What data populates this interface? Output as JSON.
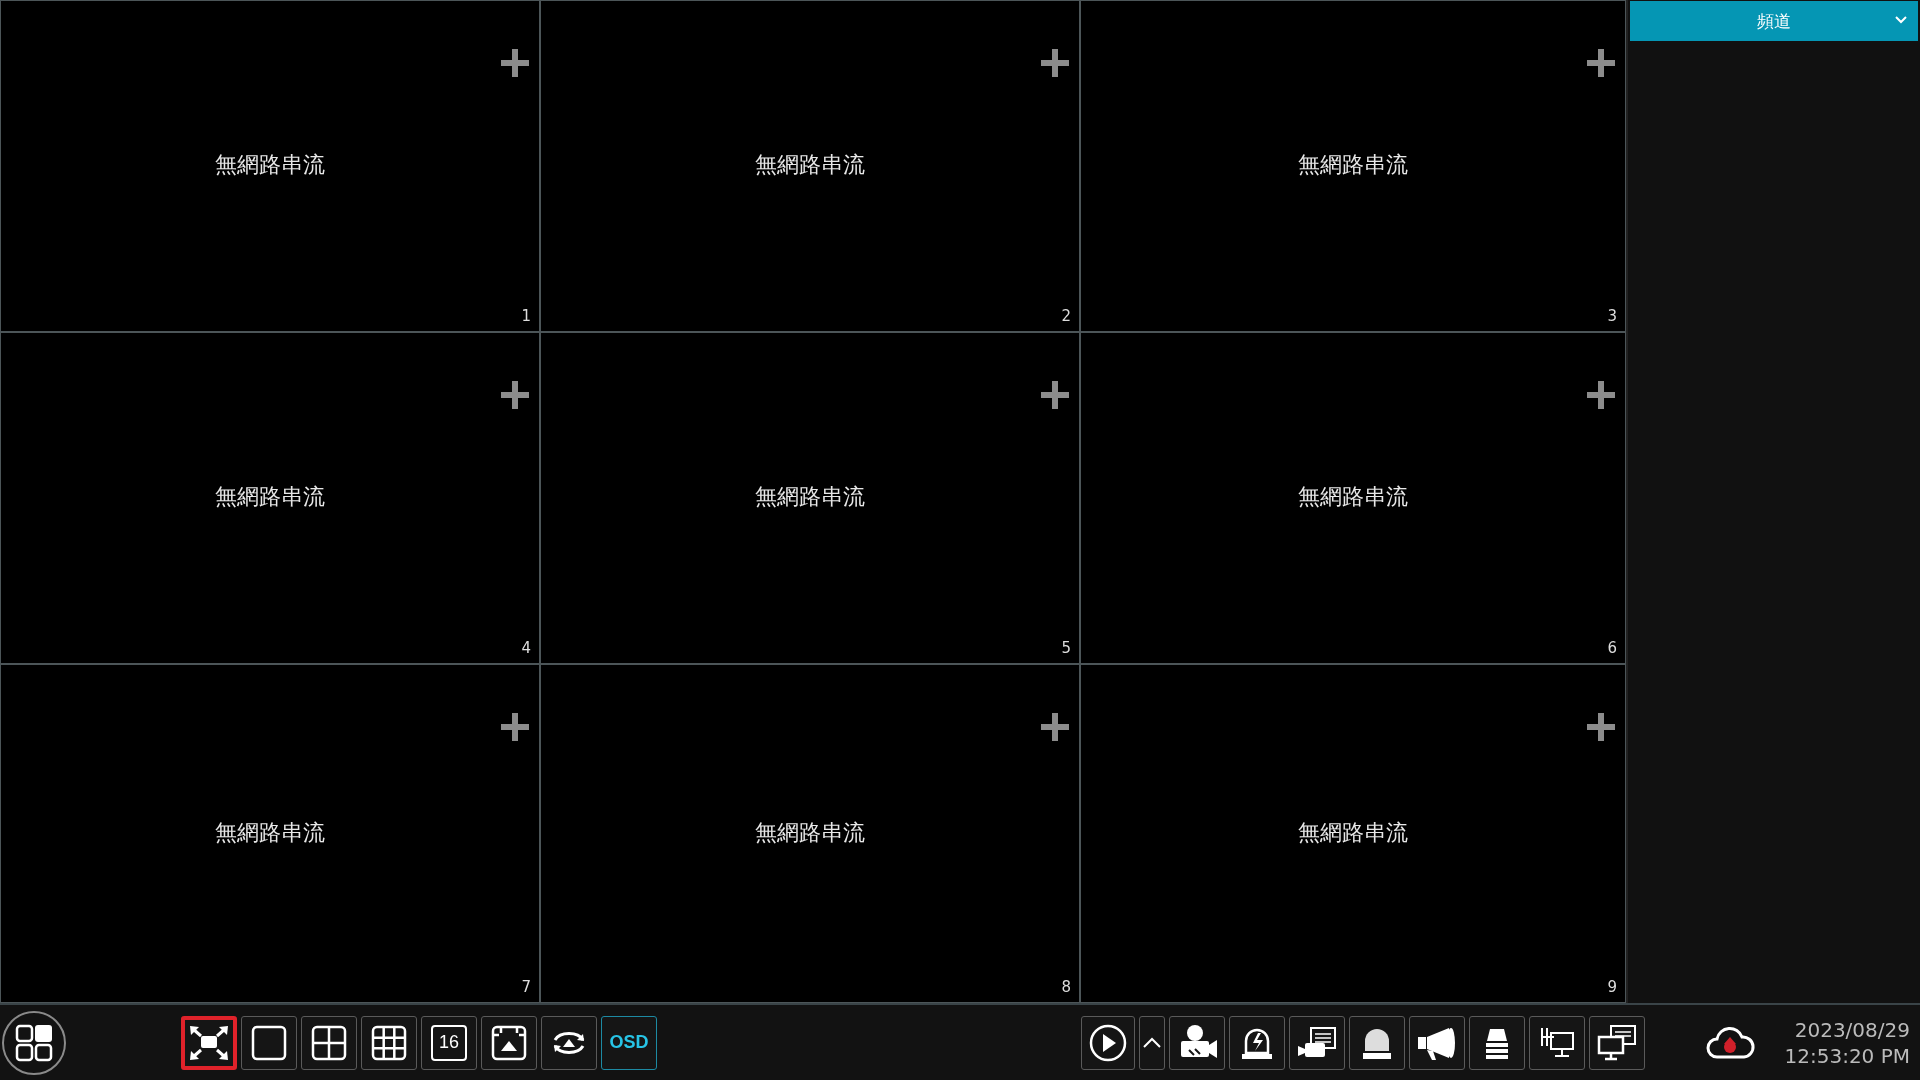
{
  "cells": [
    {
      "message": "無網路串流",
      "number": "1"
    },
    {
      "message": "無網路串流",
      "number": "2"
    },
    {
      "message": "無網路串流",
      "number": "3"
    },
    {
      "message": "無網路串流",
      "number": "4"
    },
    {
      "message": "無網路串流",
      "number": "5"
    },
    {
      "message": "無網路串流",
      "number": "6"
    },
    {
      "message": "無網路串流",
      "number": "7"
    },
    {
      "message": "無網路串流",
      "number": "8"
    },
    {
      "message": "無網路串流",
      "number": "9"
    }
  ],
  "side_panel": {
    "title": "頻道"
  },
  "layout_buttons": [
    {
      "kind": "fullscreen",
      "selected": true
    },
    {
      "kind": "single",
      "selected": false
    },
    {
      "kind": "quad",
      "selected": false
    },
    {
      "kind": "nine",
      "selected": false
    },
    {
      "kind": "sixteen",
      "label": "16",
      "selected": false
    },
    {
      "kind": "custom",
      "selected": false
    },
    {
      "kind": "sequence",
      "selected": false
    },
    {
      "kind": "osd",
      "label": "OSD",
      "selected": false
    }
  ],
  "tool_buttons": [
    {
      "kind": "play"
    },
    {
      "kind": "expand"
    },
    {
      "kind": "record"
    },
    {
      "kind": "alarm"
    },
    {
      "kind": "snapshot"
    },
    {
      "kind": "light"
    },
    {
      "kind": "audio"
    },
    {
      "kind": "disk"
    },
    {
      "kind": "network"
    },
    {
      "kind": "display"
    }
  ],
  "status": {
    "date": "2023/08/29",
    "time": "12:53:20 PM"
  }
}
